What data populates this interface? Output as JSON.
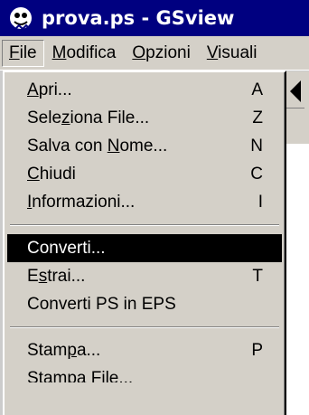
{
  "window": {
    "title": "prova.ps - GSview",
    "icon": "gsview-ghost-icon"
  },
  "menubar": {
    "items": [
      {
        "label_mnemonic": "F",
        "label_rest": "ile"
      },
      {
        "label_mnemonic": "M",
        "label_rest": "odifica"
      },
      {
        "label_mnemonic": "O",
        "label_rest": "pzioni"
      },
      {
        "label_mnemonic": "V",
        "label_rest": "isuali"
      }
    ]
  },
  "file_menu": {
    "items": [
      {
        "pre": "",
        "mn": "A",
        "post": "pri...",
        "shortcut": "A"
      },
      {
        "pre": "Sele",
        "mn": "z",
        "post": "iona File...",
        "shortcut": "Z"
      },
      {
        "pre": "Salva con ",
        "mn": "N",
        "post": "ome...",
        "shortcut": "N"
      },
      {
        "pre": "",
        "mn": "C",
        "post": "hiudi",
        "shortcut": "C"
      },
      {
        "pre": "",
        "mn": "I",
        "post": "nformazioni...",
        "shortcut": "I"
      },
      {
        "pre": "Converti...",
        "mn": "",
        "post": "",
        "shortcut": ""
      },
      {
        "pre": "E",
        "mn": "s",
        "post": "trai...",
        "shortcut": "T"
      },
      {
        "pre": "Converti PS in EPS",
        "mn": "",
        "post": "",
        "shortcut": ""
      },
      {
        "pre": "Stam",
        "mn": "p",
        "post": "a...",
        "shortcut": "P"
      },
      {
        "pre": "Stampa File...",
        "mn": "",
        "post": "",
        "shortcut": ""
      }
    ]
  }
}
